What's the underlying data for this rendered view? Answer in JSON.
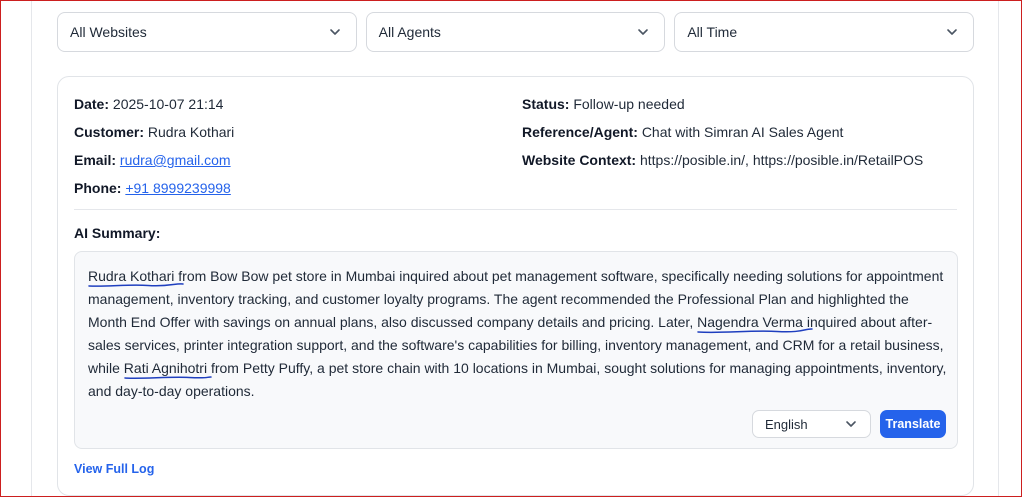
{
  "filters": {
    "websites": "All Websites",
    "agents": "All Agents",
    "time": "All Time"
  },
  "record": {
    "date_label": "Date:",
    "date": "2025-10-07 21:14",
    "customer_label": "Customer:",
    "customer": "Rudra Kothari",
    "email_label": "Email:",
    "email": "rudra@gmail.com",
    "phone_label": "Phone:",
    "phone": "+91 8999239998",
    "status_label": "Status:",
    "status": "Follow-up needed",
    "reference_label": "Reference/Agent:",
    "reference": "Chat with Simran AI Sales Agent",
    "website_label": "Website Context:",
    "website": "https://posible.in/, https://posible.in/RetailPOS"
  },
  "summary": {
    "title": "AI Summary:",
    "name1": "Rudra Kothari",
    "part1": " from Bow Bow pet store in Mumbai inquired about pet management software, specifically needing solutions for appointment management, inventory tracking, and customer loyalty programs. The agent recommended the Professional Plan and highlighted the Month End Offer with savings on annual plans, also discussed company details and pricing. Later, ",
    "name2": "Nagendra Verma",
    "part2": " inquired about after-sales services, printer integration support, and the software's capabilities for billing, inventory management, and CRM for a retail business, while ",
    "name3": "Rati Agnihotri",
    "part3": " from Petty Puffy, a pet store chain with 10 locations in Mumbai, sought solutions for managing appointments, inventory, and day-to-day operations."
  },
  "translate": {
    "language": "English",
    "button": "Translate"
  },
  "view_full_log": "View Full Log",
  "colors": {
    "accent": "#2563eb",
    "annotation": "#1f3fbf",
    "frame": "#cc1f1f"
  },
  "icons": {
    "dropdown": "chevron-down-icon"
  }
}
